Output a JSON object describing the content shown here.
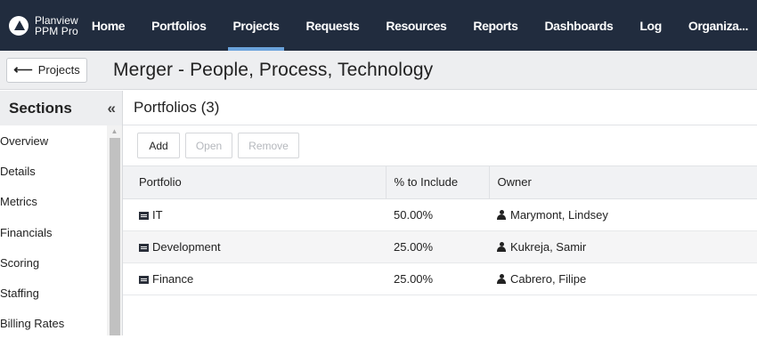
{
  "brand": {
    "line1": "Planview",
    "line2": "PPM Pro"
  },
  "nav": {
    "items": [
      "Home",
      "Portfolios",
      "Projects",
      "Requests",
      "Resources",
      "Reports",
      "Dashboards",
      "Log",
      "Organiza..."
    ],
    "active": "Projects"
  },
  "titlebar": {
    "back_label": "Projects",
    "title": "Merger - People, Process, Technology"
  },
  "sidebar": {
    "title": "Sections",
    "collapse_glyph": "«",
    "items": [
      "Overview",
      "Details",
      "Metrics",
      "Financials",
      "Scoring",
      "Staffing",
      "Billing Rates"
    ]
  },
  "main": {
    "heading": "Portfolios (3)",
    "toolbar": {
      "add": "Add",
      "open": "Open",
      "remove": "Remove"
    },
    "table": {
      "columns": [
        "Portfolio",
        "% to Include",
        "Owner"
      ],
      "rows": [
        {
          "portfolio": "IT",
          "include": "50.00%",
          "owner": "Marymont, Lindsey"
        },
        {
          "portfolio": "Development",
          "include": "25.00%",
          "owner": "Kukreja, Samir"
        },
        {
          "portfolio": "Finance",
          "include": "25.00%",
          "owner": "Cabrero, Filipe"
        }
      ]
    }
  },
  "colors": {
    "nav_bg": "#212c3e",
    "active_underline": "#6ba3dc",
    "title_bg": "#edeef0"
  }
}
